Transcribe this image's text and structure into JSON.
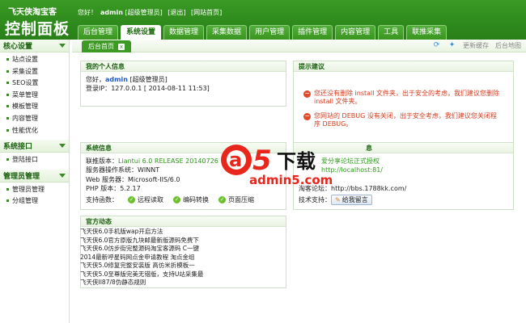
{
  "header": {
    "brand_top": "飞天侠淘宝客",
    "brand_main": "控制面板",
    "welcome": {
      "greeting": "您好！",
      "user": "admin",
      "role": "[超级管理员]",
      "logout": "[退出]",
      "site_home": "[网站首页]"
    },
    "tabs": [
      "后台管理",
      "系统设置",
      "数据管理",
      "采集数据",
      "用户管理",
      "插件管理",
      "内容管理",
      "工具",
      "联推采集"
    ],
    "active_tab": "系统设置"
  },
  "sidebar": {
    "groups": [
      {
        "title": "核心设置",
        "items": [
          "站点设置",
          "采集设置",
          "SEO设置",
          "菜单管理",
          "模板管理",
          "内容管理",
          "性能优化"
        ]
      },
      {
        "title": "系统接口",
        "items": [
          "登陆接口"
        ]
      },
      {
        "title": "管理员管理",
        "items": [
          "管理员管理",
          "分组管理"
        ]
      }
    ]
  },
  "toolbar": {
    "crumb": "后台首页",
    "close": "x",
    "update_cache": "更新缓存",
    "backend_map": "后台地图"
  },
  "my_info": {
    "title": "我的个人信息",
    "greeting": "您好，",
    "user": "admin",
    "role": "[超级管理员]",
    "login_ip_label": "登录IP：",
    "login_ip_value": "127.0.0.1 [ 2014-08-11 11:53]"
  },
  "tips": {
    "title": "提示建议",
    "items": [
      "您还没有删除 install 文件夹，出于安全的考虑，我们建议您删除 install 文件夹。",
      "您网站的 DEBUG 没有关闭，出于安全考虑，我们建议您关闭程序 DEBUG。"
    ]
  },
  "sysinfo": {
    "title": "系统信息",
    "rows": [
      {
        "label": "联推版本：",
        "value": "Liantui 6.0 RELEASE 20140726"
      },
      {
        "label": "服务器操作系统：",
        "value": "WINNT"
      },
      {
        "label": "Web 服务器：",
        "value": "Microsoft-IIS/6.0"
      },
      {
        "label": "PHP 版本：",
        "value": "5.2.17"
      }
    ],
    "support_label": "支持函数：",
    "support": [
      "远程读取",
      "编码转换",
      "页面压缩"
    ]
  },
  "aside_info": {
    "title_suffix": "息",
    "row1_value": "爱分享论坛正式授权",
    "row2_value": "http://localhost:81/",
    "forum_label": "淘客论坛：",
    "forum_value": "http://bbs.1788kk.com/",
    "support_label": "技术支持：",
    "message_button": "给我留言"
  },
  "news": {
    "title": "官方动态",
    "items": [
      "飞天侠6.0手机版wap开启方法",
      "飞天侠6.0官方原版九块邮最新版源码免费下",
      "飞天侠6.0仿步街完整源码淘宝客源码 C一键",
      "2014最新呼星码网点金申请教程 淘点金组",
      "飞天侠5.0修复完整安装版 高仿米折模板一",
      "飞天侠5.0至尊版完美无错版，支持U站采集最",
      "飞天侠II87/8伪静态规则"
    ]
  },
  "watermark": {
    "brand_a": "a",
    "brand_5": "5",
    "brand_text": "下载",
    "url": "admin5.com"
  }
}
